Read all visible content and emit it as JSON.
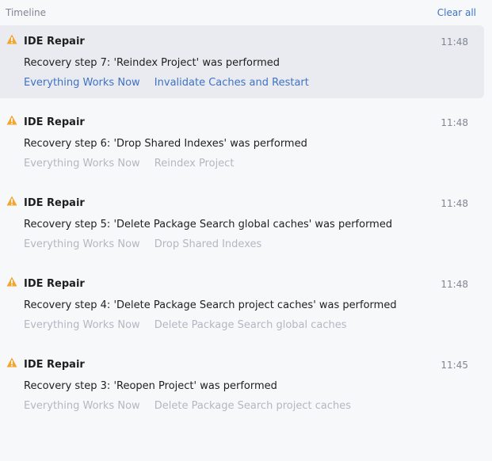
{
  "header": {
    "title": "Timeline",
    "clear_label": "Clear all"
  },
  "colors": {
    "warning": "#f0a732",
    "link": "#3f72c5",
    "muted_link": "#b3b7c1",
    "selected_bg": "#e9ebf0"
  },
  "items": [
    {
      "title": "IDE Repair",
      "time": "11:48",
      "body": "Recovery step 7: 'Reindex Project' was performed",
      "action1": "Everything Works Now",
      "action2": "Invalidate Caches and Restart",
      "icon": "warning-icon"
    },
    {
      "title": "IDE Repair",
      "time": "11:48",
      "body": "Recovery step 6: 'Drop Shared Indexes' was performed",
      "action1": "Everything Works Now",
      "action2": "Reindex Project",
      "icon": "warning-icon"
    },
    {
      "title": "IDE Repair",
      "time": "11:48",
      "body": "Recovery step 5: 'Delete Package Search global caches' was performed",
      "action1": "Everything Works Now",
      "action2": "Drop Shared Indexes",
      "icon": "warning-icon"
    },
    {
      "title": "IDE Repair",
      "time": "11:48",
      "body": "Recovery step 4: 'Delete Package Search project caches' was performed",
      "action1": "Everything Works Now",
      "action2": "Delete Package Search global caches",
      "icon": "warning-icon"
    },
    {
      "title": "IDE Repair",
      "time": "11:45",
      "body": "Recovery step 3: 'Reopen Project' was performed",
      "action1": "Everything Works Now",
      "action2": "Delete Package Search project caches",
      "icon": "warning-icon"
    }
  ]
}
